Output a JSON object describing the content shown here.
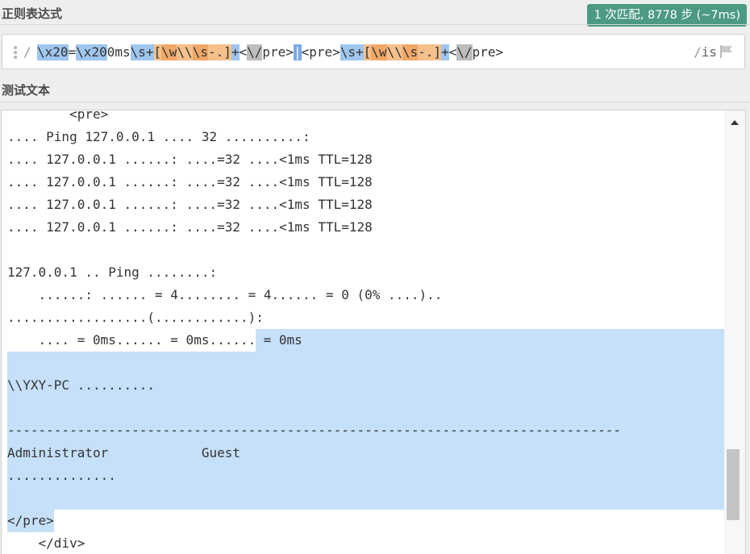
{
  "labels": {
    "regex_section": "正则表达式",
    "test_section": "测试文本"
  },
  "match_badge": "1 次匹配, 8778 步 (~7ms)",
  "regex": {
    "delimiter": "/",
    "tokens": [
      {
        "text": "\\x20",
        "kind": "esc"
      },
      {
        "text": "=",
        "kind": "plain"
      },
      {
        "text": "\\x20",
        "kind": "esc"
      },
      {
        "text": "0ms",
        "kind": "plain"
      },
      {
        "text": "\\s+",
        "kind": "quant"
      },
      {
        "text": "[",
        "kind": "set"
      },
      {
        "text": "\\w",
        "kind": "set-alt"
      },
      {
        "text": "\\\\",
        "kind": "set"
      },
      {
        "text": "\\s",
        "kind": "set-alt"
      },
      {
        "text": "-.]",
        "kind": "set"
      },
      {
        "text": "+",
        "kind": "quant"
      },
      {
        "text": "<",
        "kind": "plain"
      },
      {
        "text": "\\/",
        "kind": "escgrey"
      },
      {
        "text": "pre>",
        "kind": "plain"
      },
      {
        "text": "|",
        "kind": "alt"
      },
      {
        "text": "<pre>",
        "kind": "plain"
      },
      {
        "text": "\\s+",
        "kind": "quant"
      },
      {
        "text": "[",
        "kind": "set"
      },
      {
        "text": "\\w",
        "kind": "set-alt"
      },
      {
        "text": "\\\\",
        "kind": "set"
      },
      {
        "text": "\\s",
        "kind": "set-alt"
      },
      {
        "text": "-.]",
        "kind": "set"
      },
      {
        "text": "+",
        "kind": "quant"
      },
      {
        "text": "<",
        "kind": "plain"
      },
      {
        "text": "\\/",
        "kind": "escgrey"
      },
      {
        "text": "pre>",
        "kind": "plain"
      }
    ],
    "flags": "is"
  },
  "test_text": {
    "lines": [
      {
        "text": "        <pre>",
        "hl": "none"
      },
      {
        "text": ".... Ping 127.0.0.1 .... 32 ..........:",
        "hl": "none"
      },
      {
        "text": ".... 127.0.0.1 ......: ....=32 ....<1ms TTL=128",
        "hl": "none"
      },
      {
        "text": ".... 127.0.0.1 ......: ....=32 ....<1ms TTL=128",
        "hl": "none"
      },
      {
        "text": ".... 127.0.0.1 ......: ....=32 ....<1ms TTL=128",
        "hl": "none"
      },
      {
        "text": ".... 127.0.0.1 ......: ....=32 ....<1ms TTL=128",
        "hl": "none"
      },
      {
        "text": "",
        "hl": "none"
      },
      {
        "text": "127.0.0.1 .. Ping ........:",
        "hl": "none"
      },
      {
        "text": "    ......: ...... = 4........ = 4...... = 0 (0% ....)..",
        "hl": "none"
      },
      {
        "text": "..................(............):",
        "hl": "none"
      },
      {
        "pre": "    .... = 0ms...... = 0ms......",
        "text": " = 0ms",
        "hl": "partial"
      },
      {
        "text": "",
        "hl": "full"
      },
      {
        "text": "\\\\YXY-PC ..........",
        "hl": "full"
      },
      {
        "text": "",
        "hl": "full"
      },
      {
        "text": "-------------------------------------------------------------------------------",
        "hl": "full"
      },
      {
        "text": "Administrator            Guest",
        "hl": "full"
      },
      {
        "text": "..............",
        "hl": "full"
      },
      {
        "text": "",
        "hl": "full"
      },
      {
        "text": "</pre>",
        "hl": "inline"
      },
      {
        "text": "    </div>",
        "hl": "none"
      }
    ]
  }
}
